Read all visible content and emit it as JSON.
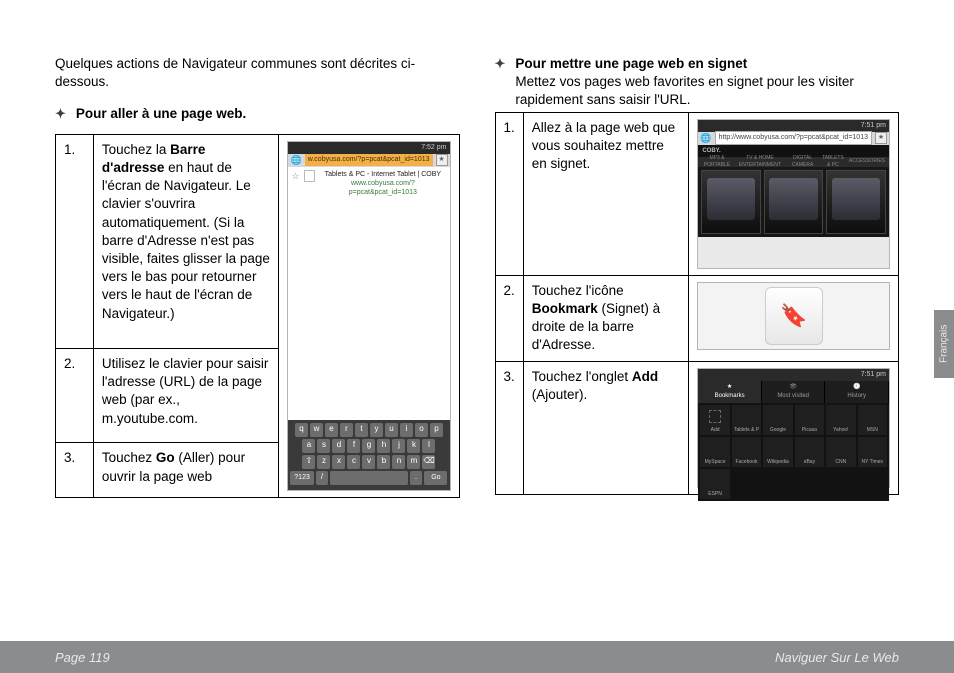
{
  "intro": "Quelques actions de Navigateur communes sont décrites ci-dessous.",
  "left": {
    "heading": "Pour aller à une page web.",
    "steps": [
      {
        "n": "1.",
        "html": "Touchez la <b>Barre d'adresse</b> en haut de l'écran de Navigateur. Le clavier s'ouvrira automatiquement. (Si la barre d'Adresse n'est pas visible, faites glisser la page vers le bas pour retourner vers le haut de l'écran de Navigateur.)"
      },
      {
        "n": "2.",
        "html": "Utilisez le clavier pour saisir l'adresse (URL) de la page web (par ex., m.youtube.com."
      },
      {
        "n": "3.",
        "html": "Touchez <b>Go</b> (Aller) pour ouvrir la page web"
      }
    ],
    "shot": {
      "time": "7:52 pm",
      "url": "w.cobyusa.com/?p=pcat&pcat_id=1013",
      "result_title": "Tablets & PC - Internet Tablet | COBY",
      "result_url": "www.cobyusa.com/?p=pcat&pcat_id=1013",
      "keys": {
        "r1": [
          "q",
          "w",
          "e",
          "r",
          "t",
          "y",
          "u",
          "i",
          "o",
          "p"
        ],
        "r2": [
          "a",
          "s",
          "d",
          "f",
          "g",
          "h",
          "j",
          "k",
          "l"
        ],
        "r3": [
          "⇧",
          "z",
          "x",
          "c",
          "v",
          "b",
          "n",
          "m",
          "⌫"
        ],
        "r4_left": "?123",
        "r4_slash": "/",
        "r4_dot": ".",
        "r4_go": "Go"
      }
    }
  },
  "right": {
    "heading": "Pour mettre une page web en signet",
    "sub": "Mettez vos pages web favorites en signet pour les visiter rapidement sans saisir l'URL.",
    "steps": [
      {
        "n": "1.",
        "html": "Allez à la page web que vous souhaitez mettre en signet."
      },
      {
        "n": "2.",
        "html": "Touchez l'icône <b>Bookmark</b> (Signet) à droite de la barre d'Adresse."
      },
      {
        "n": "3.",
        "html": "Touchez l'onglet <b>Add</b> (Ajouter)."
      }
    ],
    "shot1": {
      "time": "7:51 pm",
      "url": "http://www.cobyusa.com/?p=pcat&pcat_id=1013",
      "brand": "COBY.",
      "nav": [
        "MP3 & PORTABLE",
        "TV & HOME ENTERTAINMENT",
        "DIGITAL CAMERA",
        "TABLETS & PC",
        "ACCESSORIES"
      ]
    },
    "shot3": {
      "time": "7:51 pm",
      "tabs": [
        {
          "icon": "★",
          "label": "Bookmarks",
          "active": true
        },
        {
          "icon": "👁",
          "label": "Most visited",
          "active": false
        },
        {
          "icon": "🕘",
          "label": "History",
          "active": false
        }
      ],
      "tiles": [
        "Add",
        "Tablets & P",
        "Google",
        "Picasa",
        "Yahoo!",
        "MSN",
        "MySpace",
        "Facebook",
        "Wikipedia",
        "eBay",
        "CNN",
        "NY Times",
        "ESPN"
      ]
    }
  },
  "footer": {
    "page": "Page 119",
    "section": "Naviguer Sur Le Web"
  },
  "sidetab": "Français"
}
